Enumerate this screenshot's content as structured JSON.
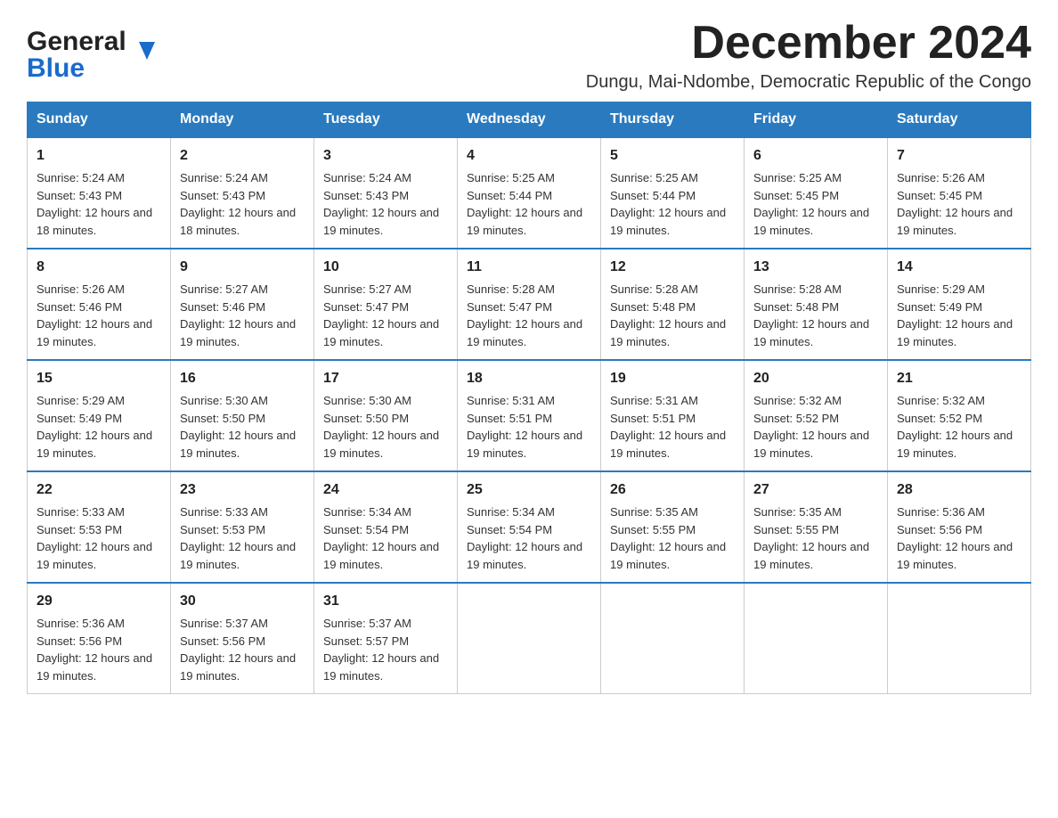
{
  "header": {
    "logo_line1": "General",
    "logo_line2": "Blue",
    "month_title": "December 2024",
    "subtitle": "Dungu, Mai-Ndombe, Democratic Republic of the Congo"
  },
  "columns": [
    "Sunday",
    "Monday",
    "Tuesday",
    "Wednesday",
    "Thursday",
    "Friday",
    "Saturday"
  ],
  "weeks": [
    [
      {
        "day": "1",
        "sunrise": "5:24 AM",
        "sunset": "5:43 PM",
        "daylight": "12 hours and 18 minutes."
      },
      {
        "day": "2",
        "sunrise": "5:24 AM",
        "sunset": "5:43 PM",
        "daylight": "12 hours and 18 minutes."
      },
      {
        "day": "3",
        "sunrise": "5:24 AM",
        "sunset": "5:43 PM",
        "daylight": "12 hours and 19 minutes."
      },
      {
        "day": "4",
        "sunrise": "5:25 AM",
        "sunset": "5:44 PM",
        "daylight": "12 hours and 19 minutes."
      },
      {
        "day": "5",
        "sunrise": "5:25 AM",
        "sunset": "5:44 PM",
        "daylight": "12 hours and 19 minutes."
      },
      {
        "day": "6",
        "sunrise": "5:25 AM",
        "sunset": "5:45 PM",
        "daylight": "12 hours and 19 minutes."
      },
      {
        "day": "7",
        "sunrise": "5:26 AM",
        "sunset": "5:45 PM",
        "daylight": "12 hours and 19 minutes."
      }
    ],
    [
      {
        "day": "8",
        "sunrise": "5:26 AM",
        "sunset": "5:46 PM",
        "daylight": "12 hours and 19 minutes."
      },
      {
        "day": "9",
        "sunrise": "5:27 AM",
        "sunset": "5:46 PM",
        "daylight": "12 hours and 19 minutes."
      },
      {
        "day": "10",
        "sunrise": "5:27 AM",
        "sunset": "5:47 PM",
        "daylight": "12 hours and 19 minutes."
      },
      {
        "day": "11",
        "sunrise": "5:28 AM",
        "sunset": "5:47 PM",
        "daylight": "12 hours and 19 minutes."
      },
      {
        "day": "12",
        "sunrise": "5:28 AM",
        "sunset": "5:48 PM",
        "daylight": "12 hours and 19 minutes."
      },
      {
        "day": "13",
        "sunrise": "5:28 AM",
        "sunset": "5:48 PM",
        "daylight": "12 hours and 19 minutes."
      },
      {
        "day": "14",
        "sunrise": "5:29 AM",
        "sunset": "5:49 PM",
        "daylight": "12 hours and 19 minutes."
      }
    ],
    [
      {
        "day": "15",
        "sunrise": "5:29 AM",
        "sunset": "5:49 PM",
        "daylight": "12 hours and 19 minutes."
      },
      {
        "day": "16",
        "sunrise": "5:30 AM",
        "sunset": "5:50 PM",
        "daylight": "12 hours and 19 minutes."
      },
      {
        "day": "17",
        "sunrise": "5:30 AM",
        "sunset": "5:50 PM",
        "daylight": "12 hours and 19 minutes."
      },
      {
        "day": "18",
        "sunrise": "5:31 AM",
        "sunset": "5:51 PM",
        "daylight": "12 hours and 19 minutes."
      },
      {
        "day": "19",
        "sunrise": "5:31 AM",
        "sunset": "5:51 PM",
        "daylight": "12 hours and 19 minutes."
      },
      {
        "day": "20",
        "sunrise": "5:32 AM",
        "sunset": "5:52 PM",
        "daylight": "12 hours and 19 minutes."
      },
      {
        "day": "21",
        "sunrise": "5:32 AM",
        "sunset": "5:52 PM",
        "daylight": "12 hours and 19 minutes."
      }
    ],
    [
      {
        "day": "22",
        "sunrise": "5:33 AM",
        "sunset": "5:53 PM",
        "daylight": "12 hours and 19 minutes."
      },
      {
        "day": "23",
        "sunrise": "5:33 AM",
        "sunset": "5:53 PM",
        "daylight": "12 hours and 19 minutes."
      },
      {
        "day": "24",
        "sunrise": "5:34 AM",
        "sunset": "5:54 PM",
        "daylight": "12 hours and 19 minutes."
      },
      {
        "day": "25",
        "sunrise": "5:34 AM",
        "sunset": "5:54 PM",
        "daylight": "12 hours and 19 minutes."
      },
      {
        "day": "26",
        "sunrise": "5:35 AM",
        "sunset": "5:55 PM",
        "daylight": "12 hours and 19 minutes."
      },
      {
        "day": "27",
        "sunrise": "5:35 AM",
        "sunset": "5:55 PM",
        "daylight": "12 hours and 19 minutes."
      },
      {
        "day": "28",
        "sunrise": "5:36 AM",
        "sunset": "5:56 PM",
        "daylight": "12 hours and 19 minutes."
      }
    ],
    [
      {
        "day": "29",
        "sunrise": "5:36 AM",
        "sunset": "5:56 PM",
        "daylight": "12 hours and 19 minutes."
      },
      {
        "day": "30",
        "sunrise": "5:37 AM",
        "sunset": "5:56 PM",
        "daylight": "12 hours and 19 minutes."
      },
      {
        "day": "31",
        "sunrise": "5:37 AM",
        "sunset": "5:57 PM",
        "daylight": "12 hours and 19 minutes."
      },
      null,
      null,
      null,
      null
    ]
  ]
}
